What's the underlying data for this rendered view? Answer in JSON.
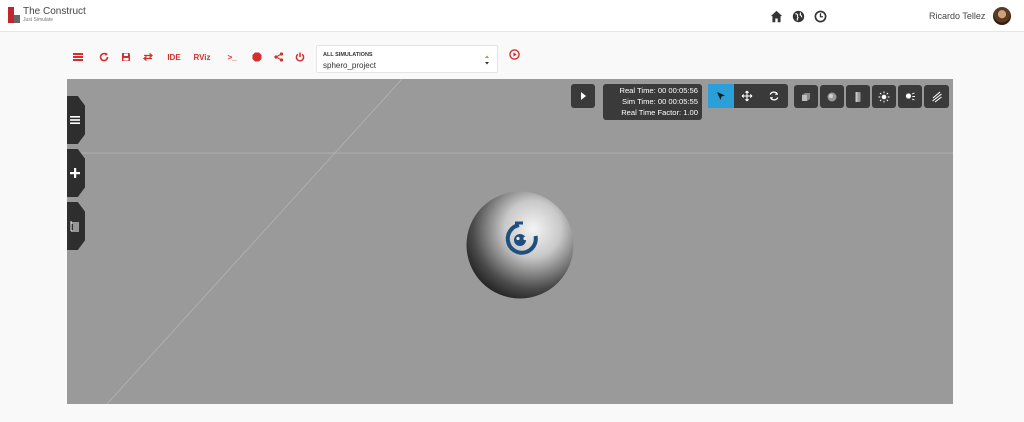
{
  "header": {
    "brand_name": "The Construct",
    "brand_tagline": "Just Simulate",
    "user_name": "Ricardo Tellez",
    "icons": [
      "home-icon",
      "globe-icon",
      "clock-icon"
    ]
  },
  "toolbar": {
    "ide_label": "IDE",
    "rviz_label": "RViz",
    "terminal_label": ">_",
    "icons": [
      "list-icon",
      "reload-icon",
      "save-icon",
      "swap-icon",
      "terminal-icon",
      "stop-icon",
      "share-icon",
      "power-icon",
      "play-icon"
    ],
    "accent_color": "#d32f2f"
  },
  "simulation_select": {
    "label": "ALL SIMULATIONS",
    "value": "sphero_project"
  },
  "gazebo": {
    "real_time": "Real Time: 00 00:05:56",
    "sim_time": "Sim Time: 00 00:05:55",
    "real_time_factor": "Real Time Factor: 1.00",
    "tools": [
      "play-icon",
      "select-mode-icon",
      "translate-mode-icon",
      "rotate-mode-icon",
      "box-icon",
      "sphere-icon",
      "cylinder-icon",
      "point-light-icon",
      "spot-light-icon",
      "directional-light-icon"
    ],
    "side_tabs": [
      "menu-icon",
      "insert-icon",
      "layers-icon"
    ],
    "active_tool_color": "#2a9fd8"
  }
}
